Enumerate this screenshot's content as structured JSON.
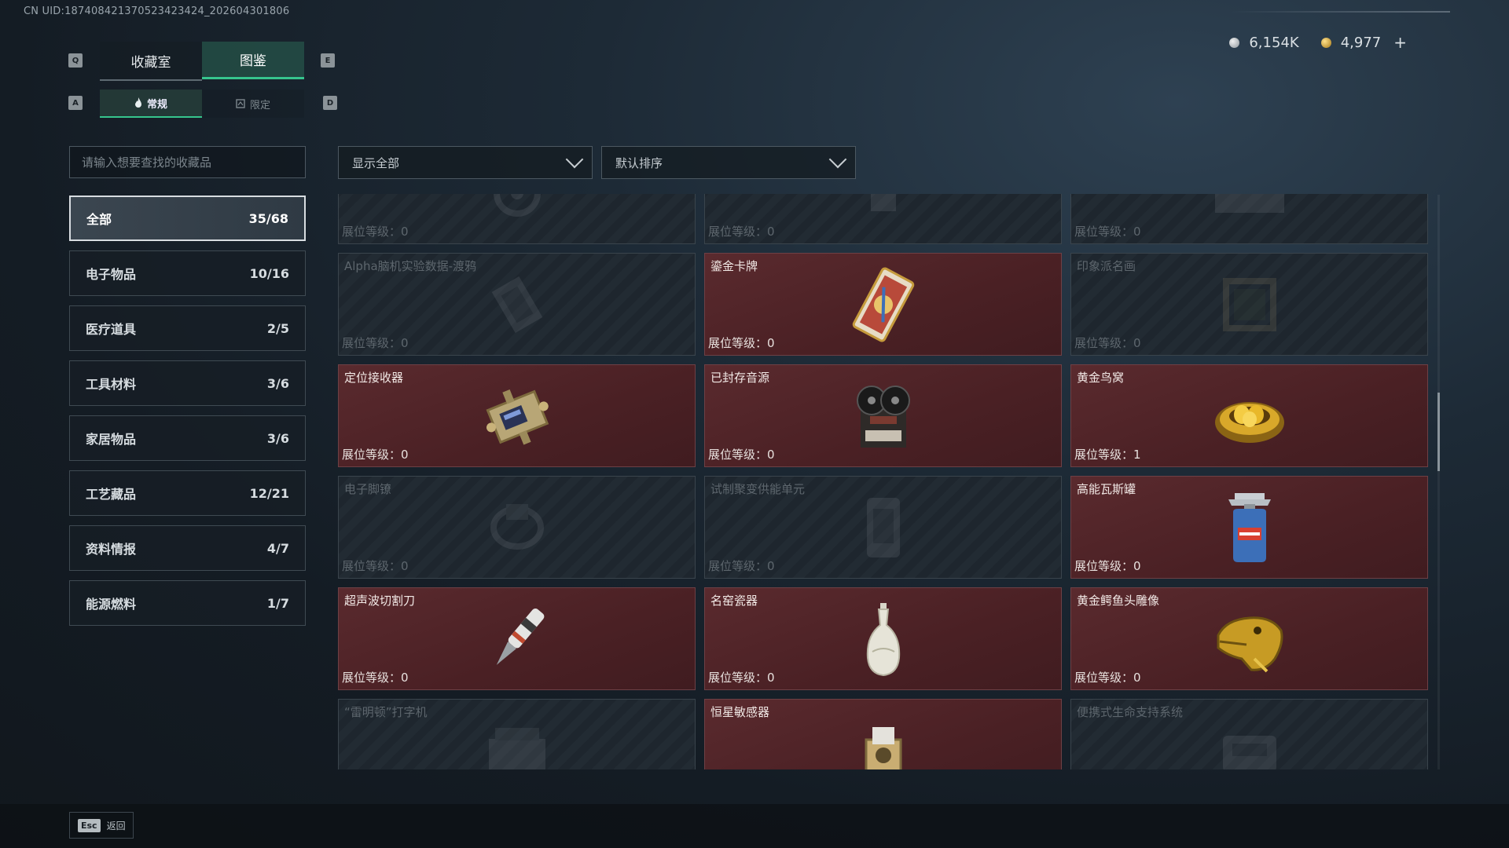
{
  "uid": "CN UID:18740842137052342342​4_202604301806",
  "currency": {
    "silver": "6,154K",
    "gold": "4,977",
    "plus": "+"
  },
  "keys": {
    "q": "Q",
    "e": "E",
    "a": "A",
    "d": "D"
  },
  "tabs": [
    {
      "label": "收藏室"
    },
    {
      "label": "图鉴"
    }
  ],
  "subtabs": [
    {
      "label": "常规"
    },
    {
      "label": "限定"
    }
  ],
  "search": {
    "placeholder": "请输入想要查找的收藏品"
  },
  "filters": {
    "show": "显示全部",
    "sort": "默认排序"
  },
  "categories": [
    {
      "label": "全部",
      "count": "35/68"
    },
    {
      "label": "电子物品",
      "count": "10/16"
    },
    {
      "label": "医疗道具",
      "count": "2/5"
    },
    {
      "label": "工具材料",
      "count": "3/6"
    },
    {
      "label": "家居物品",
      "count": "3/6"
    },
    {
      "label": "工艺藏品",
      "count": "12/21"
    },
    {
      "label": "资料情报",
      "count": "4/7"
    },
    {
      "label": "能源燃料",
      "count": "1/7"
    }
  ],
  "items": [
    {
      "name": "",
      "level": "展位等级：0",
      "owned": false,
      "icon": "gear-icon"
    },
    {
      "name": "",
      "level": "展位等级：0",
      "owned": false,
      "icon": "device-icon"
    },
    {
      "name": "",
      "level": "展位等级：0",
      "owned": false,
      "icon": "box-icon"
    },
    {
      "name": "Alpha脑机实验数据-渡鸦",
      "level": "展位等级：0",
      "owned": false,
      "icon": "chip-icon"
    },
    {
      "name": "鎏金卡牌",
      "level": "展位等级：0",
      "owned": true,
      "icon": "gilded-card-icon"
    },
    {
      "name": "印象派名画",
      "level": "展位等级：0",
      "owned": false,
      "icon": "painting-icon"
    },
    {
      "name": "定位接收器",
      "level": "展位等级：0",
      "owned": true,
      "icon": "receiver-icon"
    },
    {
      "name": "已封存音源",
      "level": "展位等级：0",
      "owned": true,
      "icon": "reel-recorder-icon"
    },
    {
      "name": "黄金鸟窝",
      "level": "展位等级：1",
      "owned": true,
      "icon": "golden-nest-icon"
    },
    {
      "name": "电子脚镣",
      "level": "展位等级：0",
      "owned": false,
      "icon": "anklet-icon"
    },
    {
      "name": "试制聚变供能单元",
      "level": "展位等级：0",
      "owned": false,
      "icon": "fusion-cell-icon"
    },
    {
      "name": "高能瓦斯罐",
      "level": "展位等级：0",
      "owned": true,
      "icon": "gas-canister-icon"
    },
    {
      "name": "超声波切割刀",
      "level": "展位等级：0",
      "owned": true,
      "icon": "ultrasonic-cutter-icon"
    },
    {
      "name": "名窑瓷器",
      "level": "展位等级：0",
      "owned": true,
      "icon": "porcelain-vase-icon"
    },
    {
      "name": "黄金鳄鱼头雕像",
      "level": "展位等级：0",
      "owned": true,
      "icon": "golden-croc-head-icon"
    },
    {
      "name": "“雷明顿”打字机",
      "level": "",
      "owned": false,
      "icon": "typewriter-icon"
    },
    {
      "name": "恒星敏感器",
      "level": "",
      "owned": true,
      "icon": "star-sensor-icon"
    },
    {
      "name": "便携式生命支持系统",
      "level": "",
      "owned": false,
      "icon": "life-support-icon"
    }
  ],
  "footer": {
    "esc_key": "Esc",
    "esc_label": "返回"
  }
}
